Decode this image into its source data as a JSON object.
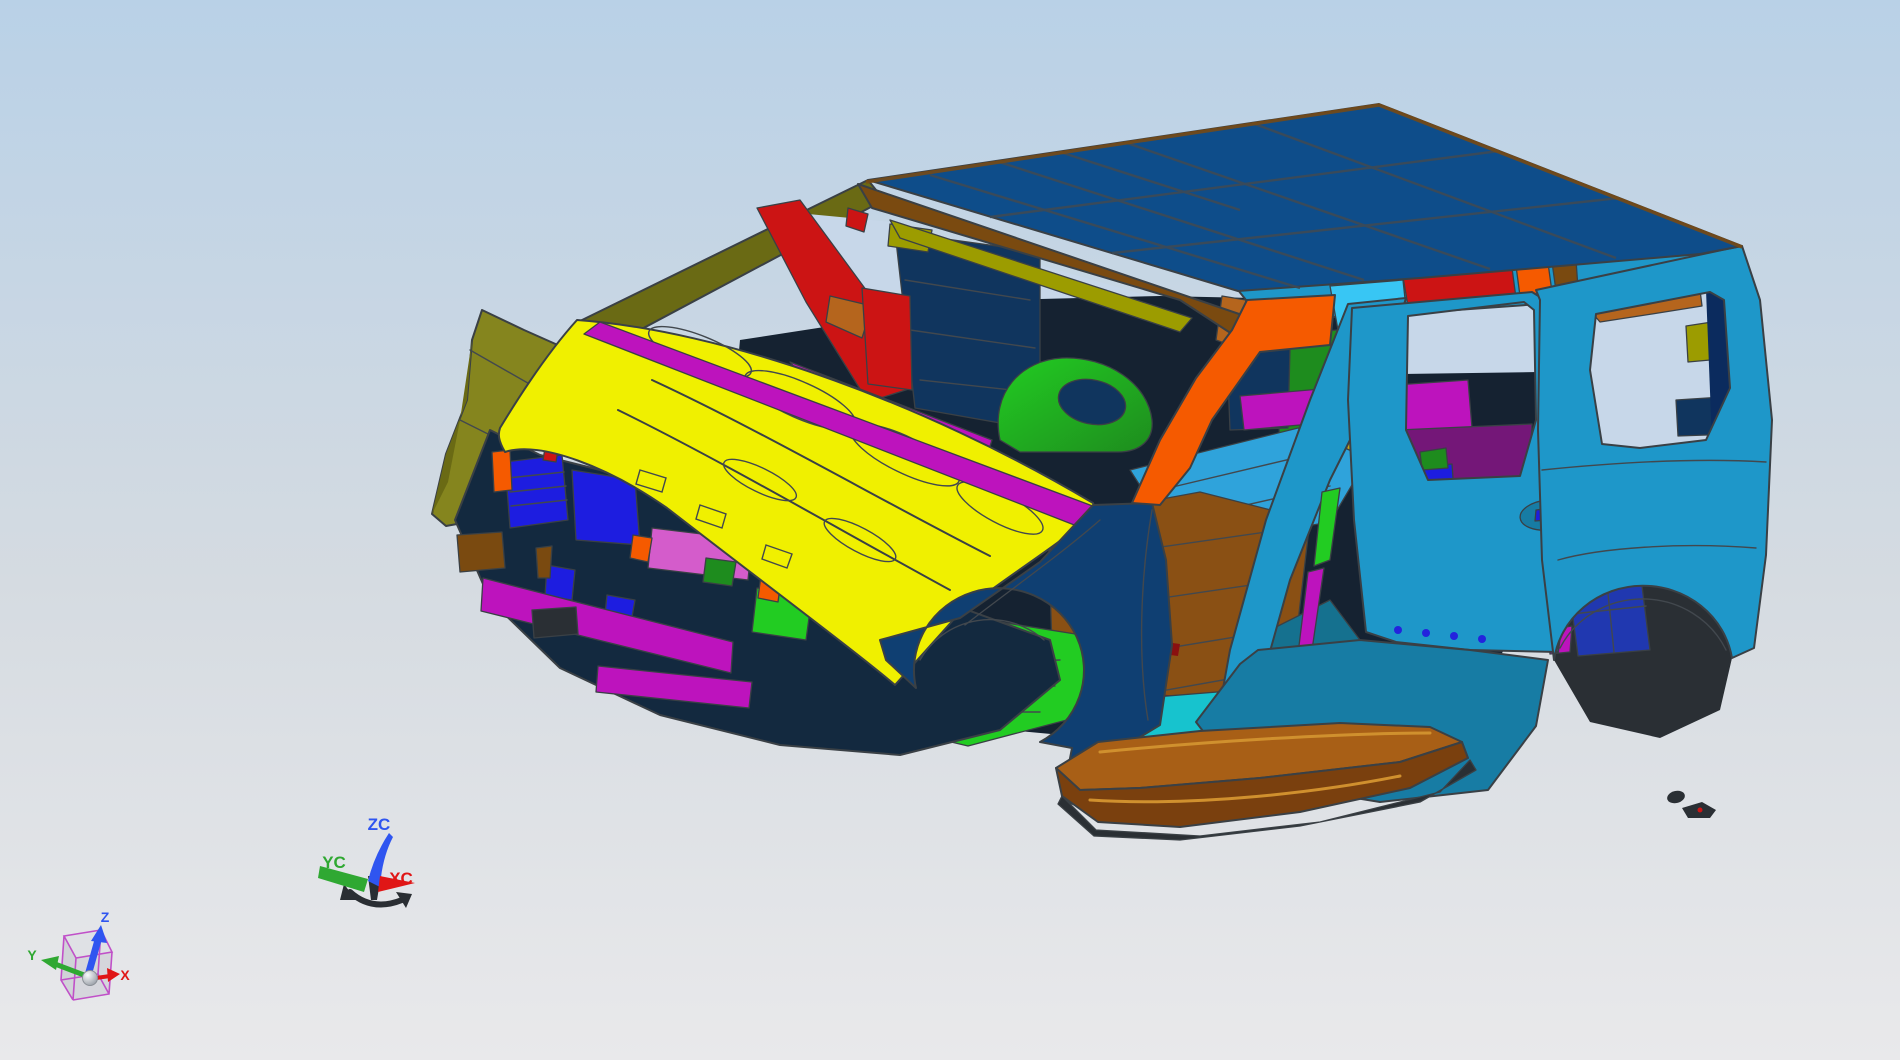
{
  "scene": {
    "background": {
      "top": "#B9D1E7",
      "middle": "#D5DBE1",
      "bottom": "#E9E9EB"
    }
  },
  "model": {
    "palette": {
      "roof": "#0E4D8A",
      "roof_line": "#3E4A55",
      "side": "#1E97C9",
      "side_dark": "#177CA4",
      "inner_teal": "#15718F",
      "bright_cyan": "#38C6F4",
      "aqua": "#17C3CE",
      "floor_blue": "#2FA3DB",
      "fender": "#0F3F72",
      "dash_navy": "#10355E",
      "gate_navy": "#0B2B5E",
      "wheel_blue": "#2038B0",
      "navy_dark": "#13293F",
      "royal_blue": "#1D1DE0",
      "bolt_blue": "#2323DD",
      "hood": "#F0F000",
      "hood_line": "#6A6A22",
      "olive": "#85851E",
      "olive_dark": "#6A6A14",
      "olive_strip": "#9C9C00",
      "gold": "#C8A418",
      "rail_brown": "#7A4A10",
      "copper": "#B5651D",
      "floor_brown": "#8A5014",
      "step_top": "#A85F16",
      "step_front": "#7A400E",
      "step_light": "#D0902E",
      "magenta": "#BD13BD",
      "pink": "#D45CCB",
      "purple": "#741778",
      "red": "#CC1414",
      "red_dark": "#8A1010",
      "orange": "#F55A00",
      "green": "#22CC22",
      "green_dark": "#1E8C1E",
      "dark_part": "#2A2F34",
      "interior_dark": "#152231",
      "sky_hole": "#C7D7E9",
      "sphere_light": "#FAFBFC",
      "sphere_dark": "#9AA0A8"
    }
  },
  "triads": {
    "axis_colors": {
      "x": "#E01616",
      "y": "#2FA832",
      "z": "#2F55F0"
    },
    "wcs": {
      "x_label": "XC",
      "y_label": "YC",
      "z_label": "ZC"
    },
    "view": {
      "x_label": "X",
      "y_label": "Y",
      "z_label": "Z",
      "cube_color": "#C050C8"
    }
  }
}
